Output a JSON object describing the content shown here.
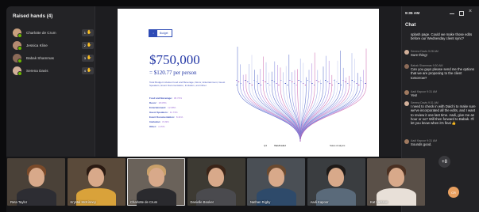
{
  "raised_hands": {
    "title": "Raised hands (4)",
    "people": [
      {
        "name": "Charlotte de Crum",
        "order": "1",
        "avatar_color": "#c9a07e"
      },
      {
        "name": "Jessica Kline",
        "order": "2",
        "avatar_color": "#b58a72"
      },
      {
        "name": "Babak Shammas",
        "order": "3",
        "avatar_color": "#8b6a58"
      },
      {
        "name": "Serena Davis",
        "order": "4",
        "avatar_color": "#d2b09a"
      }
    ]
  },
  "slide": {
    "logo_label": "Budget",
    "amount": "$750,000",
    "per_person": "= $120.77 per person",
    "description": "Total Budget includes Food and Beverage, Décor, Entertainment, Guest Speakers, Event Documentation, Invitation, and Other.",
    "line_items": [
      {
        "label": "Food and Beverage:",
        "value": "36.74%"
      },
      {
        "label": "Decor:",
        "value": "18.05%"
      },
      {
        "label": "Entertainment:",
        "value": "12.08%"
      },
      {
        "label": "Guest Speakers:",
        "value": "11.73%"
      },
      {
        "label": "Event Documentation:",
        "value": "8.41%"
      },
      {
        "label": "Invitation:",
        "value": "8.33%"
      },
      {
        "label": "Other:",
        "value": "4.15%"
      }
    ],
    "footer_left": "Q3",
    "footer_center": "VanArsdel",
    "footer_right": "Sales Analysis"
  },
  "chat": {
    "clock": "9:35 AM",
    "title": "Chat",
    "messages": [
      {
        "meta": "",
        "text": "splash page. Could we make those edits before our Wednesday client sync?",
        "color": ""
      },
      {
        "meta": "Serena Davis  9:28 AM",
        "text": "Sure thing!",
        "color": "#d2b09a"
      },
      {
        "meta": "Babak Shammas  9:30 AM",
        "text": "Can you guys please send me the options that we are proposing to the client tomorrow?",
        "color": "#8b6a58"
      },
      {
        "meta": "Aadi Kapoor  9:31 AM",
        "text": "Yes!",
        "color": "#a07a60"
      },
      {
        "meta": "Serena Davis  9:31 AM",
        "text": "I need to check in with Daichi to make sure we've incorporated all the edits, and I want to review it one last time. Aadi, give me an hour or so? Will then forward to Babak. I'll let you know when it's final 👍",
        "color": "#d2b09a"
      },
      {
        "meta": "Aadi Kapoor  9:31 AM",
        "text": "Sounds good.",
        "color": "#a07a60"
      }
    ]
  },
  "participants": [
    {
      "name": "Reta Taylor",
      "bg": "#4a4138",
      "hair": "#7a4a2a",
      "shirt": "#2d2d33"
    },
    {
      "name": "Krystal McKinney",
      "bg": "#5a4a3a",
      "hair": "#2a1a12",
      "shirt": "#d9a23a"
    },
    {
      "name": "Charlotte de Crum",
      "bg": "#6a625a",
      "hair": "#c9a06a",
      "shirt": "#2a2a2e"
    },
    {
      "name": "Danielle Booker",
      "bg": "#3d3a33",
      "hair": "#3a2418",
      "shirt": "#4a4a4e"
    },
    {
      "name": "Nathan Rigby",
      "bg": "#4a4f55",
      "hair": "#6a4a30",
      "shirt": "#2e4a6a"
    },
    {
      "name": "Aadi Kapoor",
      "bg": "#3a3d40",
      "hair": "#1e1a18",
      "shirt": "#5a6a7a"
    },
    {
      "name": "Kat Larsson",
      "bg": "#5a5048",
      "hair": "#4a3022",
      "shirt": "#e8e0d8"
    }
  ],
  "overflow_count": "+8",
  "self_initials": "CR"
}
